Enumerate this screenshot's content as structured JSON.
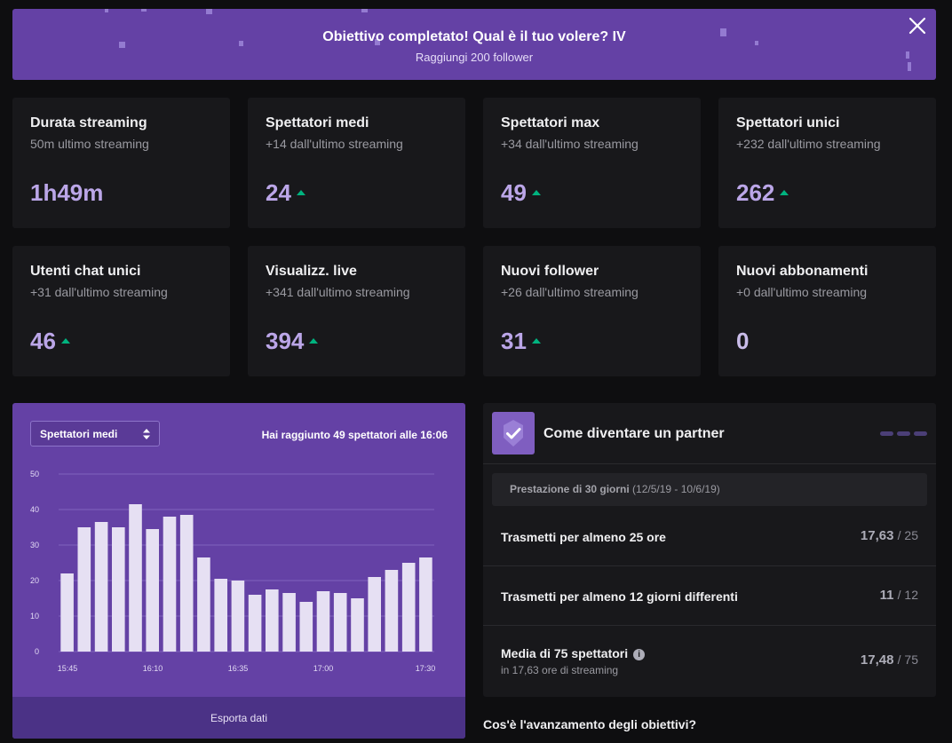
{
  "banner": {
    "title": "Obiettivo completato! Qual è il tuo volere? IV",
    "subtitle": "Raggiungi 200 follower",
    "close_icon": "close-icon",
    "background": "#6441a5"
  },
  "stats": [
    {
      "title": "Durata streaming",
      "subtitle": "50m ultimo streaming",
      "value": "1h49m",
      "trend": "none"
    },
    {
      "title": "Spettatori medi",
      "subtitle": "+14 dall'ultimo streaming",
      "value": "24",
      "trend": "up"
    },
    {
      "title": "Spettatori max",
      "subtitle": "+34 dall'ultimo streaming",
      "value": "49",
      "trend": "up"
    },
    {
      "title": "Spettatori unici",
      "subtitle": "+232 dall'ultimo streaming",
      "value": "262",
      "trend": "up"
    },
    {
      "title": "Utenti chat unici",
      "subtitle": "+31 dall'ultimo streaming",
      "value": "46",
      "trend": "up"
    },
    {
      "title": "Visualizz. live",
      "subtitle": "+341 dall'ultimo streaming",
      "value": "394",
      "trend": "up"
    },
    {
      "title": "Nuovi follower",
      "subtitle": "+26 dall'ultimo streaming",
      "value": "31",
      "trend": "up"
    },
    {
      "title": "Nuovi abbonamenti",
      "subtitle": "+0 dall'ultimo streaming",
      "value": "0",
      "trend": "none"
    }
  ],
  "chart_panel": {
    "select_value": "Spettatori medi",
    "note_prefix": "Hai raggiunto ",
    "note_value": "49 spettatori",
    "note_suffix": " alle 16:06",
    "export_label": "Esporta dati"
  },
  "chart_data": {
    "type": "bar",
    "title": "",
    "xlabel": "",
    "ylabel": "",
    "ylim": [
      0,
      50
    ],
    "yticks": [
      0,
      10,
      20,
      30,
      40,
      50
    ],
    "xtick_labels": [
      "15:45",
      "16:10",
      "16:35",
      "17:00",
      "17:30"
    ],
    "grid": true,
    "values": [
      22,
      35,
      36.5,
      35,
      41.5,
      34.5,
      38,
      38.5,
      26.5,
      20.5,
      20,
      16,
      17.5,
      16.5,
      14,
      17,
      16.5,
      15,
      21,
      23,
      25,
      26.5
    ],
    "bar_color": "#e6e0f3"
  },
  "partner": {
    "title": "Come diventare un partner",
    "badge_icon": "check-icon",
    "period_label": "Prestazione di 30 giorni",
    "period_range": "(12/5/19 - 10/6/19)",
    "requirements": [
      {
        "label": "Trasmetti per almeno 25 ore",
        "sub": "",
        "value": "17,63",
        "target": "/ 25"
      },
      {
        "label": "Trasmetti per almeno 12 giorni differenti",
        "sub": "",
        "value": "11",
        "target": "/ 12"
      },
      {
        "label": "Media di 75 spettatori",
        "sub": "in 17,63 ore di streaming",
        "value": "17,48",
        "target": "/ 75"
      }
    ]
  },
  "faq": {
    "label": "Cos'è l'avanzamento degli obiettivi?"
  }
}
